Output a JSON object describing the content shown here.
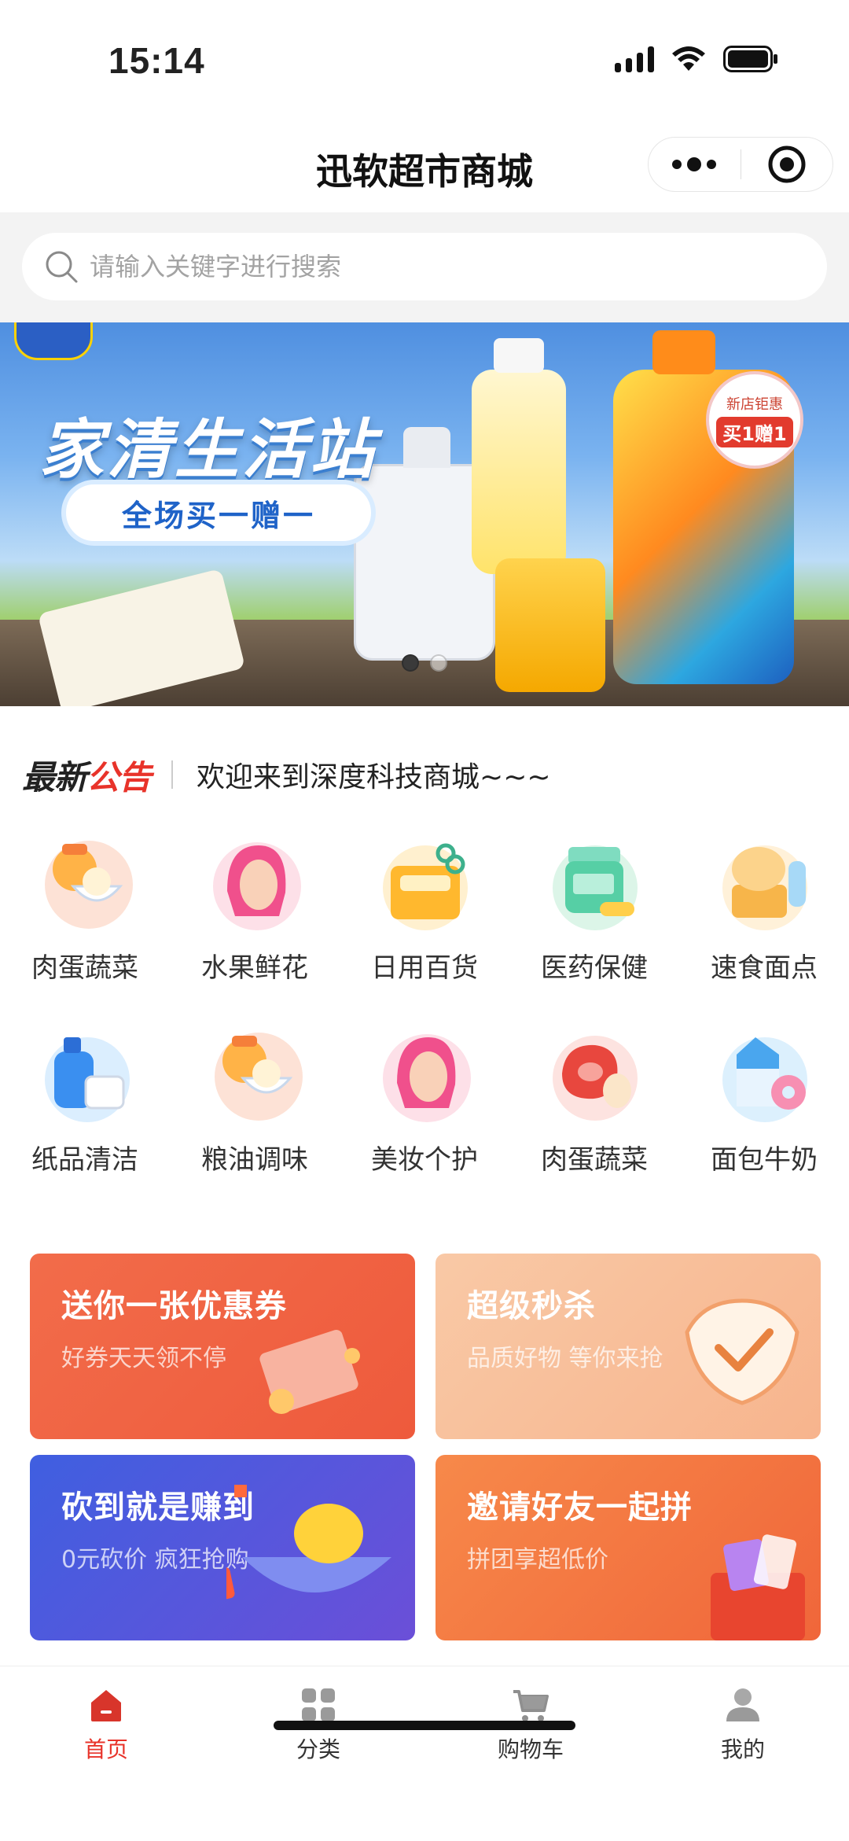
{
  "status_bar": {
    "time": "15:14"
  },
  "header": {
    "title": "迅软超市商城"
  },
  "search": {
    "placeholder": "请输入关键字进行搜索"
  },
  "banner": {
    "title": "家清生活站",
    "pill": "全场买一赠一",
    "promo_badge_top": "新店钜惠",
    "promo_badge_main": "买1赠1",
    "dots": 2,
    "active_dot": 1
  },
  "notice": {
    "logo_part1": "最新",
    "logo_part2": "公告",
    "text": "欢迎来到深度科技商城~~~"
  },
  "categories": [
    {
      "label": "肉蛋蔬菜",
      "icon": "rice-bowl-icon"
    },
    {
      "label": "水果鲜花",
      "icon": "face-avatar-icon"
    },
    {
      "label": "日用百货",
      "icon": "scissors-box-icon"
    },
    {
      "label": "医药保健",
      "icon": "medicine-jar-icon"
    },
    {
      "label": "速食面点",
      "icon": "bread-icecream-icon"
    },
    {
      "label": "纸品清洁",
      "icon": "detergent-bottle-icon"
    },
    {
      "label": "粮油调味",
      "icon": "rice-bowl-icon"
    },
    {
      "label": "美妆个护",
      "icon": "face-avatar-icon"
    },
    {
      "label": "肉蛋蔬菜",
      "icon": "meat-egg-icon"
    },
    {
      "label": "面包牛奶",
      "icon": "milk-donut-icon"
    }
  ],
  "promos": [
    {
      "title": "送你一张优惠券",
      "subtitle": "好券天天领不停"
    },
    {
      "title": "超级秒杀",
      "subtitle": "品质好物 等你来抢"
    },
    {
      "title": "砍到就是赚到",
      "subtitle": "0元砍价 疯狂抢购"
    },
    {
      "title": "邀请好友一起拼",
      "subtitle": "拼团享超低价"
    }
  ],
  "tabs": [
    {
      "label": "首页",
      "icon": "home-icon",
      "active": true
    },
    {
      "label": "分类",
      "icon": "grid-icon",
      "active": false
    },
    {
      "label": "购物车",
      "icon": "cart-icon",
      "active": false
    },
    {
      "label": "我的",
      "icon": "user-icon",
      "active": false
    }
  ],
  "colors": {
    "accent": "#e8332a",
    "coupon": "#f26c4a",
    "seckill": "#f7b48d",
    "bargain": "#4a5be0",
    "group": "#f7894a"
  }
}
